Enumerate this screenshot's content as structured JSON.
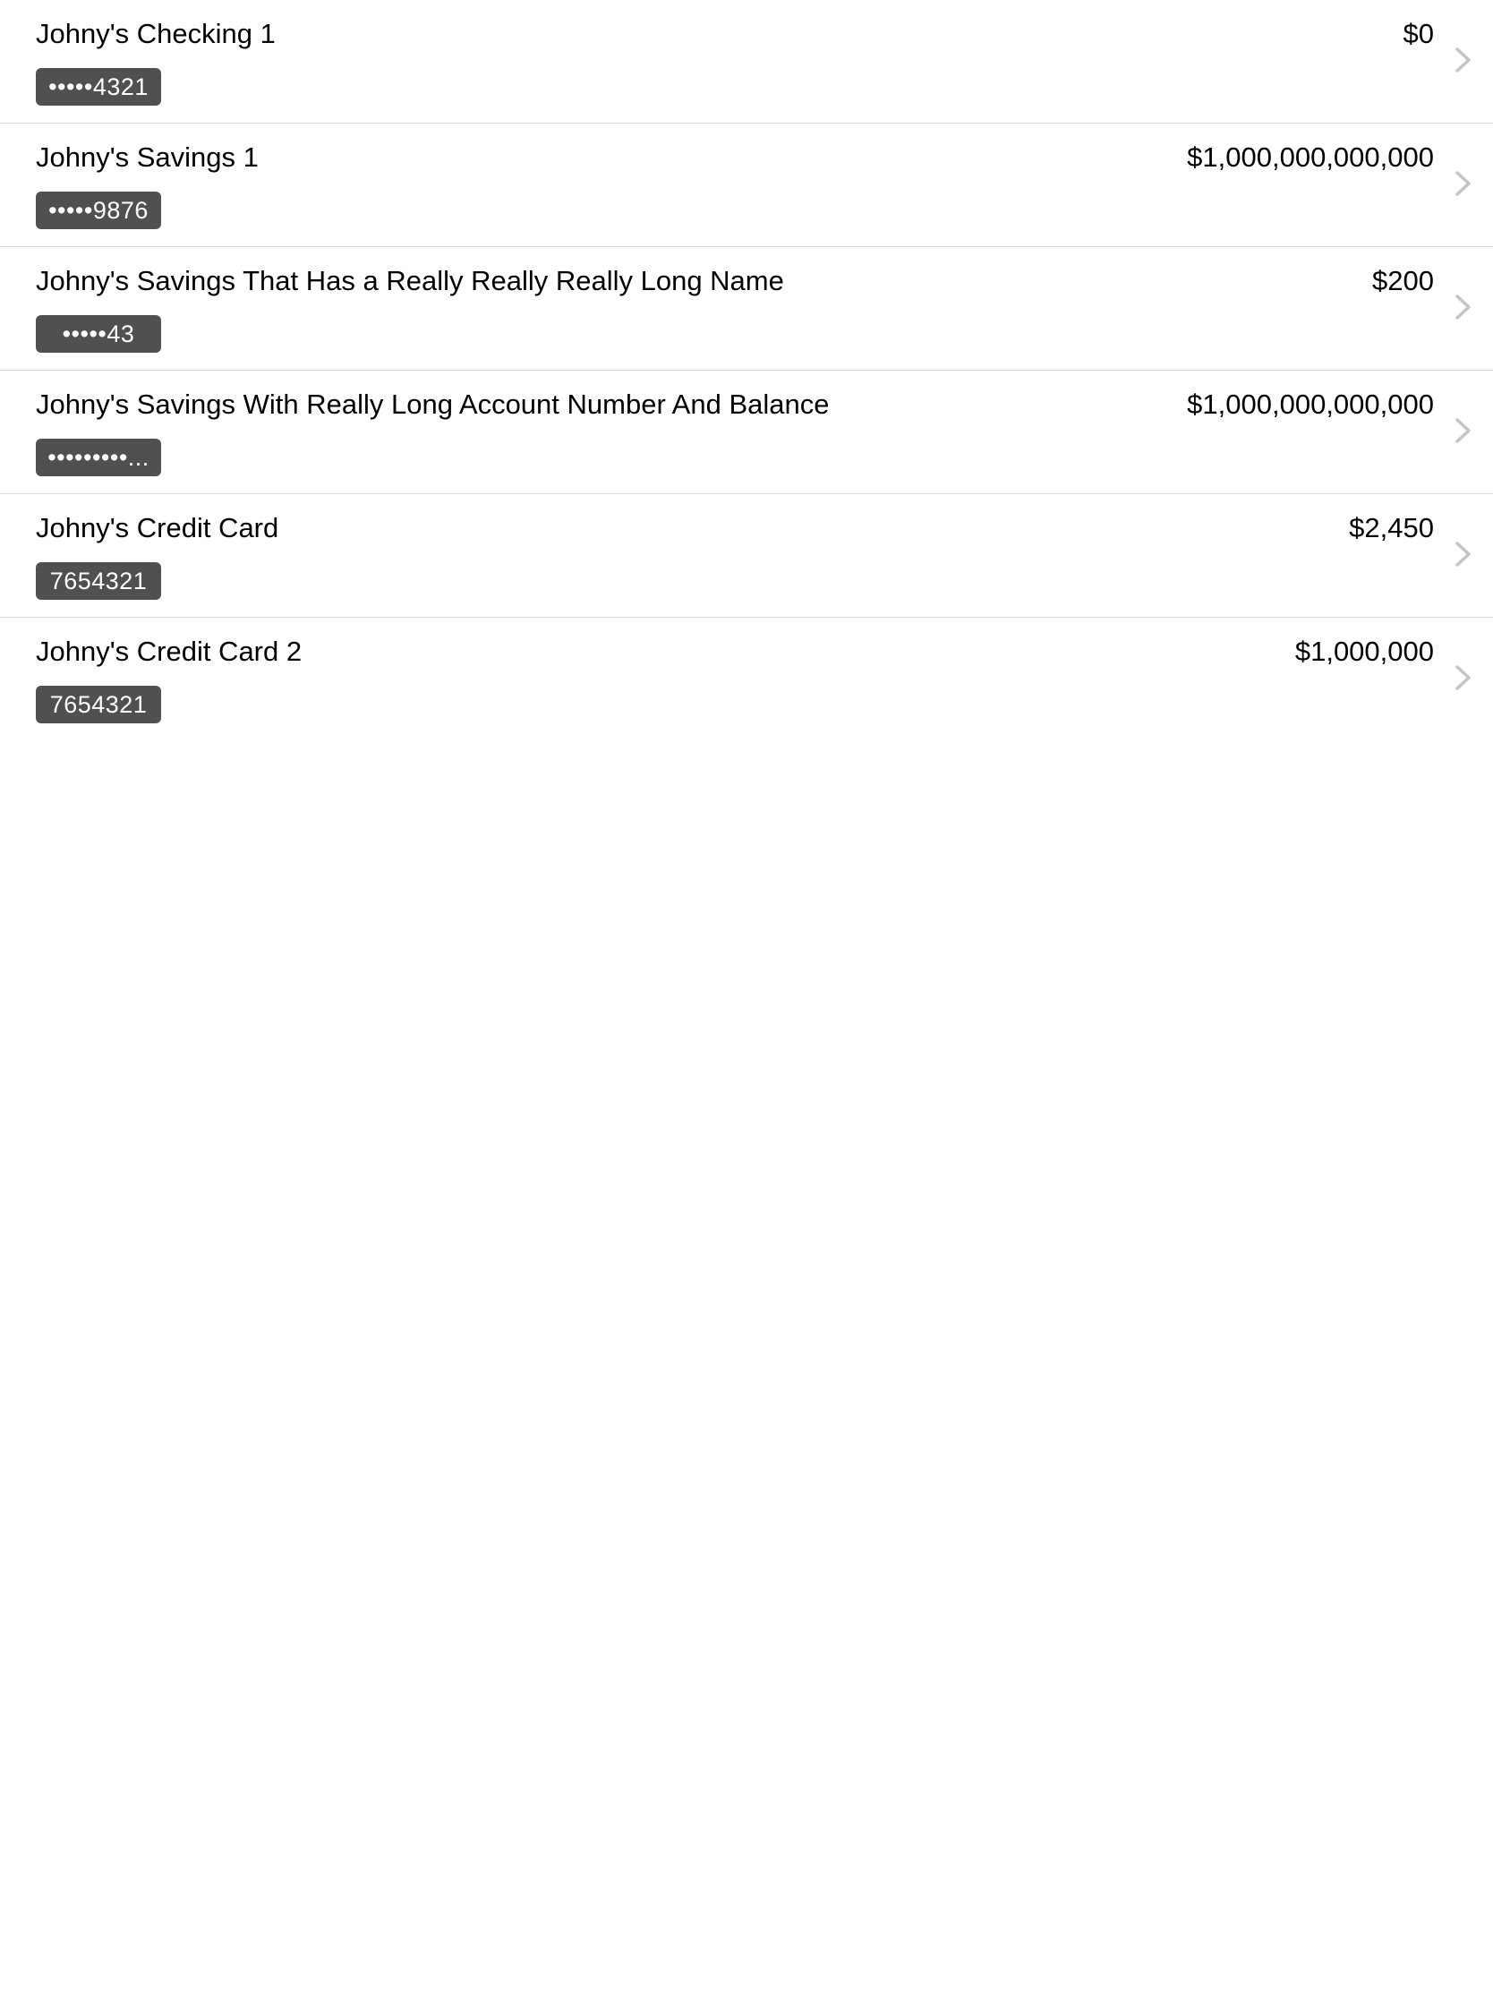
{
  "accounts": [
    {
      "name": "Johny's Checking 1",
      "number": "•••••4321",
      "balance": "$0",
      "chevron_icon": "chevron-right-icon"
    },
    {
      "name": "Johny's Savings 1",
      "number": "•••••9876",
      "balance": "$1,000,000,000,000",
      "chevron_icon": "chevron-right-icon"
    },
    {
      "name": "Johny's Savings That Has a Really Really Really Long Name",
      "number": "•••••43",
      "balance": "$200",
      "chevron_icon": "chevron-right-icon"
    },
    {
      "name": "Johny's Savings With Really Long Account Number And Balance",
      "number": "•••••••••...",
      "balance": "$1,000,000,000,000",
      "chevron_icon": "chevron-right-icon"
    },
    {
      "name": "Johny's Credit Card",
      "number": "7654321",
      "balance": "$2,450",
      "chevron_icon": "chevron-right-icon"
    },
    {
      "name": "Johny's Credit Card 2",
      "number": "7654321",
      "balance": "$1,000,000",
      "chevron_icon": "chevron-right-icon"
    }
  ],
  "colors": {
    "badge_background": "#505050",
    "separator": "#d6d6d9",
    "chevron": "#c4c4c7"
  }
}
